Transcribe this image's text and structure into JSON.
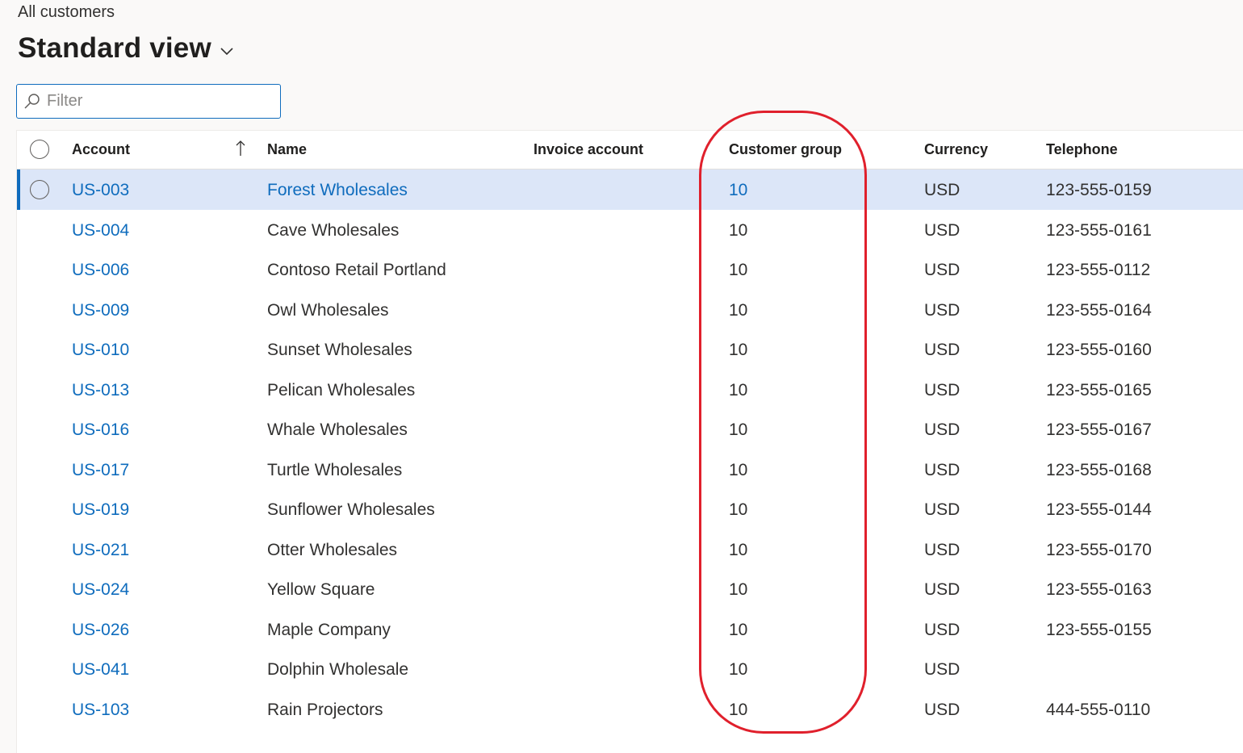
{
  "page": {
    "breadcrumb": "All customers",
    "view_title": "Standard view",
    "accent_color": "#0f6cbd",
    "selected_row_color": "#dce6f8",
    "highlight_color": "#e0202c"
  },
  "filter": {
    "placeholder": "Filter",
    "value": "",
    "icon": "search-icon"
  },
  "grid": {
    "columns": {
      "account": "Account",
      "name": "Name",
      "invoice_account": "Invoice account",
      "customer_group": "Customer group",
      "currency": "Currency",
      "telephone": "Telephone"
    },
    "sort": {
      "column": "Account",
      "direction": "ascending",
      "icon": "arrow-up-icon"
    },
    "rows": [
      {
        "account": "US-003",
        "name": "Forest Wholesales",
        "invoice_account": "",
        "customer_group": "10",
        "currency": "USD",
        "telephone": "123-555-0159",
        "selected": true
      },
      {
        "account": "US-004",
        "name": "Cave Wholesales",
        "invoice_account": "",
        "customer_group": "10",
        "currency": "USD",
        "telephone": "123-555-0161",
        "selected": false
      },
      {
        "account": "US-006",
        "name": "Contoso Retail Portland",
        "invoice_account": "",
        "customer_group": "10",
        "currency": "USD",
        "telephone": "123-555-0112",
        "selected": false
      },
      {
        "account": "US-009",
        "name": "Owl Wholesales",
        "invoice_account": "",
        "customer_group": "10",
        "currency": "USD",
        "telephone": "123-555-0164",
        "selected": false
      },
      {
        "account": "US-010",
        "name": "Sunset Wholesales",
        "invoice_account": "",
        "customer_group": "10",
        "currency": "USD",
        "telephone": "123-555-0160",
        "selected": false
      },
      {
        "account": "US-013",
        "name": "Pelican Wholesales",
        "invoice_account": "",
        "customer_group": "10",
        "currency": "USD",
        "telephone": "123-555-0165",
        "selected": false
      },
      {
        "account": "US-016",
        "name": "Whale Wholesales",
        "invoice_account": "",
        "customer_group": "10",
        "currency": "USD",
        "telephone": "123-555-0167",
        "selected": false
      },
      {
        "account": "US-017",
        "name": "Turtle Wholesales",
        "invoice_account": "",
        "customer_group": "10",
        "currency": "USD",
        "telephone": "123-555-0168",
        "selected": false
      },
      {
        "account": "US-019",
        "name": "Sunflower Wholesales",
        "invoice_account": "",
        "customer_group": "10",
        "currency": "USD",
        "telephone": "123-555-0144",
        "selected": false
      },
      {
        "account": "US-021",
        "name": "Otter Wholesales",
        "invoice_account": "",
        "customer_group": "10",
        "currency": "USD",
        "telephone": "123-555-0170",
        "selected": false
      },
      {
        "account": "US-024",
        "name": "Yellow Square",
        "invoice_account": "",
        "customer_group": "10",
        "currency": "USD",
        "telephone": "123-555-0163",
        "selected": false
      },
      {
        "account": "US-026",
        "name": "Maple Company",
        "invoice_account": "",
        "customer_group": "10",
        "currency": "USD",
        "telephone": "123-555-0155",
        "selected": false
      },
      {
        "account": "US-041",
        "name": "Dolphin Wholesale",
        "invoice_account": "",
        "customer_group": "10",
        "currency": "USD",
        "telephone": "",
        "selected": false
      },
      {
        "account": "US-103",
        "name": "Rain Projectors",
        "invoice_account": "",
        "customer_group": "10",
        "currency": "USD",
        "telephone": "444-555-0110",
        "selected": false
      }
    ]
  }
}
